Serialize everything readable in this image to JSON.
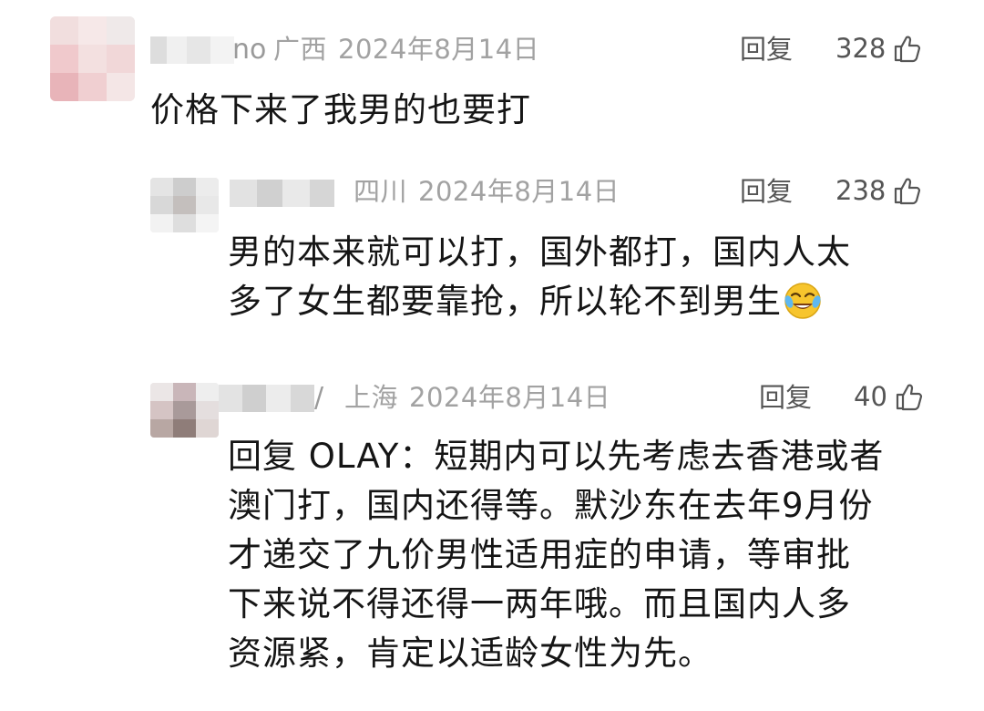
{
  "comments": [
    {
      "name_tail": "no",
      "location": "广西",
      "date": "2024年8月14日",
      "reply_label": "回复",
      "likes": "328",
      "text": "价格下来了我男的也要打"
    },
    {
      "name_tail": "",
      "location": "四川",
      "date": "2024年8月14日",
      "reply_label": "回复",
      "likes": "238",
      "text_line1": "男的本来就可以打，国外都打，国内人太",
      "text_line2": "多了女生都要靠抢，所以轮不到男生",
      "emoji": "crying-laughing-emoji"
    },
    {
      "name_tail": "/",
      "location": "上海",
      "date": "2024年8月14日",
      "reply_label": "回复",
      "likes": "40",
      "reply_prefix": "回复 OLAY：",
      "text_line1": "短期内可以先考虑去香港或者",
      "text_line2": "澳门打，国内还得等。默沙东在去年9月份",
      "text_line3": "才递交了九价男性适用症的申请，等审批",
      "text_line4": "下来说不得还得一两年哦。而且国内人多",
      "text_line5": "资源紧，肯定以适龄女性为先。"
    }
  ],
  "colors": {
    "meta": "#a2a2a2",
    "action": "#555555",
    "text": "#151515"
  }
}
